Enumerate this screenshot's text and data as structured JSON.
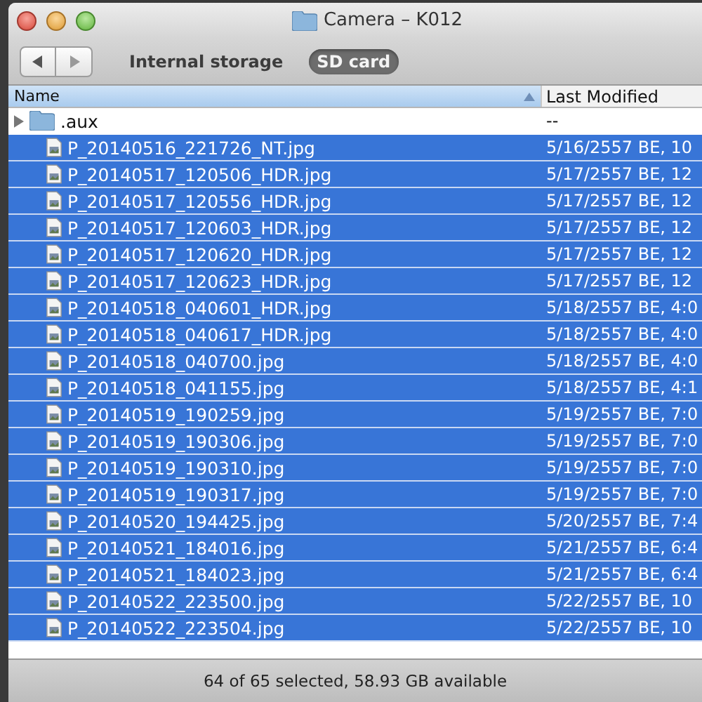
{
  "window": {
    "title": "Camera – K012"
  },
  "toolbar": {
    "locations": [
      {
        "label": "Internal storage",
        "selected": false
      },
      {
        "label": "SD card",
        "selected": true
      }
    ]
  },
  "table": {
    "columns": [
      {
        "label": "Name",
        "sorted": true
      },
      {
        "label": "Last Modified",
        "sorted": false
      }
    ],
    "rows": [
      {
        "kind": "folder",
        "name": ".aux",
        "modified": "--",
        "selected": false,
        "expanded": false
      },
      {
        "kind": "file",
        "name": "P_20140516_221726_NT.jpg",
        "modified": "5/16/2557 BE, 10",
        "selected": true
      },
      {
        "kind": "file",
        "name": "P_20140517_120506_HDR.jpg",
        "modified": "5/17/2557 BE, 12",
        "selected": true
      },
      {
        "kind": "file",
        "name": "P_20140517_120556_HDR.jpg",
        "modified": "5/17/2557 BE, 12",
        "selected": true
      },
      {
        "kind": "file",
        "name": "P_20140517_120603_HDR.jpg",
        "modified": "5/17/2557 BE, 12",
        "selected": true
      },
      {
        "kind": "file",
        "name": "P_20140517_120620_HDR.jpg",
        "modified": "5/17/2557 BE, 12",
        "selected": true
      },
      {
        "kind": "file",
        "name": "P_20140517_120623_HDR.jpg",
        "modified": "5/17/2557 BE, 12",
        "selected": true
      },
      {
        "kind": "file",
        "name": "P_20140518_040601_HDR.jpg",
        "modified": "5/18/2557 BE, 4:0",
        "selected": true
      },
      {
        "kind": "file",
        "name": "P_20140518_040617_HDR.jpg",
        "modified": "5/18/2557 BE, 4:0",
        "selected": true
      },
      {
        "kind": "file",
        "name": "P_20140518_040700.jpg",
        "modified": "5/18/2557 BE, 4:0",
        "selected": true
      },
      {
        "kind": "file",
        "name": "P_20140518_041155.jpg",
        "modified": "5/18/2557 BE, 4:1",
        "selected": true
      },
      {
        "kind": "file",
        "name": "P_20140519_190259.jpg",
        "modified": "5/19/2557 BE, 7:0",
        "selected": true
      },
      {
        "kind": "file",
        "name": "P_20140519_190306.jpg",
        "modified": "5/19/2557 BE, 7:0",
        "selected": true
      },
      {
        "kind": "file",
        "name": "P_20140519_190310.jpg",
        "modified": "5/19/2557 BE, 7:0",
        "selected": true
      },
      {
        "kind": "file",
        "name": "P_20140519_190317.jpg",
        "modified": "5/19/2557 BE, 7:0",
        "selected": true
      },
      {
        "kind": "file",
        "name": "P_20140520_194425.jpg",
        "modified": "5/20/2557 BE, 7:4",
        "selected": true
      },
      {
        "kind": "file",
        "name": "P_20140521_184016.jpg",
        "modified": "5/21/2557 BE, 6:4",
        "selected": true
      },
      {
        "kind": "file",
        "name": "P_20140521_184023.jpg",
        "modified": "5/21/2557 BE, 6:4",
        "selected": true
      },
      {
        "kind": "file",
        "name": "P_20140522_223500.jpg",
        "modified": "5/22/2557 BE, 10",
        "selected": true
      },
      {
        "kind": "file",
        "name": "P_20140522_223504.jpg",
        "modified": "5/22/2557 BE, 10",
        "selected": true
      }
    ]
  },
  "status_bar": "64 of 65 selected, 58.93 GB available"
}
